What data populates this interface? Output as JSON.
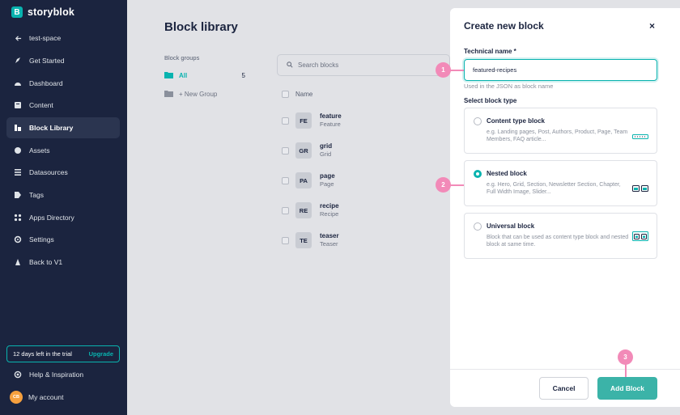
{
  "sidebar": {
    "brand": "storyblok",
    "brand_letter": "B",
    "items": [
      {
        "label": "test-space"
      },
      {
        "label": "Get Started"
      },
      {
        "label": "Dashboard"
      },
      {
        "label": "Content"
      },
      {
        "label": "Block Library"
      },
      {
        "label": "Assets"
      },
      {
        "label": "Datasources"
      },
      {
        "label": "Tags"
      },
      {
        "label": "Apps Directory"
      },
      {
        "label": "Settings"
      },
      {
        "label": "Back to V1"
      }
    ],
    "active_item": "Block Library",
    "trial_text": "12 days left in the trial",
    "upgrade_label": "Upgrade",
    "help_label": "Help & Inspiration",
    "account_label": "My account",
    "avatar_initials": "CB"
  },
  "main": {
    "title": "Block library",
    "groups_label": "Block groups",
    "group_all": "All",
    "group_all_count": "5",
    "new_group": "+ New Group",
    "search_placeholder": "Search blocks",
    "col_name": "Name",
    "blocks": [
      {
        "badge": "FE",
        "name": "feature",
        "display": "Feature"
      },
      {
        "badge": "GR",
        "name": "grid",
        "display": "Grid"
      },
      {
        "badge": "PA",
        "name": "page",
        "display": "Page"
      },
      {
        "badge": "RE",
        "name": "recipe",
        "display": "Recipe"
      },
      {
        "badge": "TE",
        "name": "teaser",
        "display": "Teaser"
      }
    ]
  },
  "panel": {
    "title": "Create new block",
    "close": "×",
    "tech_name_label": "Technical name *",
    "tech_name_value": "featured-recipes",
    "tech_name_help": "Used in the JSON as block name",
    "type_label": "Select block type",
    "options": [
      {
        "title": "Content type block",
        "desc": "e.g. Landing pages, Post, Authors, Product, Page, Team Members, FAQ article...",
        "selected": false
      },
      {
        "title": "Nested block",
        "desc": "e.g. Hero, Grid, Section, Newsletter Section, Chapter, Full Width Image, Slider...",
        "selected": true
      },
      {
        "title": "Universal block",
        "desc": "Block that can be used as content type block and nested block at same time.",
        "selected": false
      }
    ],
    "cancel_label": "Cancel",
    "add_label": "Add Block"
  },
  "steps": [
    "1",
    "2",
    "3"
  ],
  "colors": {
    "sidebar_bg": "#1b243f",
    "accent": "#09b3af",
    "overlay": "#e1e2e6",
    "step_marker": "#f28ab8"
  }
}
